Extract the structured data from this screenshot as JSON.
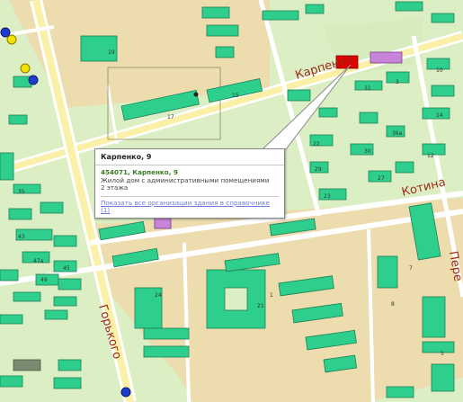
{
  "streets": {
    "karpenko": "Карпенко",
    "kotina": "Котина",
    "gorkogo": "Горького",
    "perekop": "Пере"
  },
  "building_numbers": {
    "b17": "17",
    "b15": "15",
    "b21": "21",
    "b36a": "36а",
    "b19": "19",
    "b22": "22",
    "b47a": "47а",
    "b43": "43",
    "b30": "30",
    "b29": "29",
    "b35": "35",
    "b27": "27",
    "b45": "45",
    "b49": "49",
    "b7": "7",
    "b8": "8",
    "b5": "5",
    "b1": "1",
    "b12": "12",
    "b10": "10",
    "b3": "3",
    "b31": "31",
    "b14": "14",
    "b23": "23",
    "b24": "24"
  },
  "popup": {
    "title": "Карпенко, 9",
    "address": "454071, Карпенко, 9",
    "description_line1": "Жилой дом с административными помещениями",
    "description_line2": "2 этажа",
    "link": "Показать все организации здания в справочнике",
    "link_count": "(1)"
  },
  "colors": {
    "background": "#dcefc4",
    "block": "#ecdcae",
    "road": "#ffffff",
    "main_road": "#fbf0a8",
    "building": "#2ecf8c",
    "building_dark": "#1d7f55",
    "selected": "#e00000",
    "street_label": "#9b2a17"
  },
  "markers": {
    "blue": "#1f3dcc",
    "yellow": "#f2e200"
  }
}
